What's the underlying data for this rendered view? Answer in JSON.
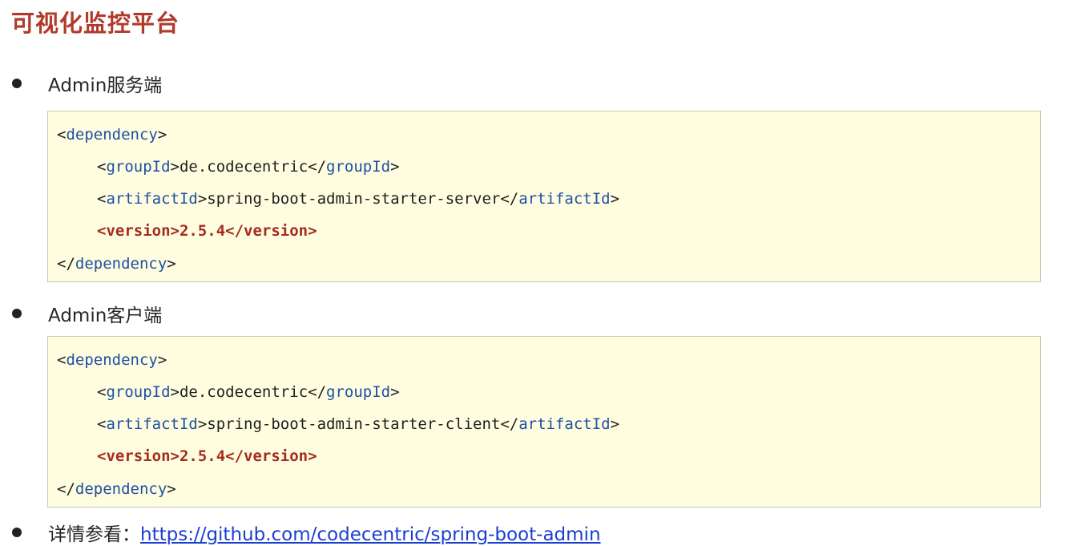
{
  "title": "可视化监控平台",
  "sections": [
    {
      "bullet": "Admin服务端",
      "code": {
        "dependency_tag": "dependency",
        "group_tag": "groupId",
        "group_value": "de.codecentric",
        "artifact_tag": "artifactId",
        "artifact_value": "spring-boot-admin-starter-server",
        "version_line": "<version>2.5.4</version>"
      }
    },
    {
      "bullet": "Admin客户端",
      "code": {
        "dependency_tag": "dependency",
        "group_tag": "groupId",
        "group_value": "de.codecentric",
        "artifact_tag": "artifactId",
        "artifact_value": "spring-boot-admin-starter-client",
        "version_line": "<version>2.5.4</version>"
      }
    }
  ],
  "details": {
    "label": "详情参看：",
    "link": "https://github.com/codecentric/spring-boot-admin"
  },
  "colors": {
    "title": "#b23a2a",
    "code_background": "#fffde0",
    "tag": "#1f4fa3",
    "version": "#a52b1f",
    "link": "#1a3fcf"
  }
}
